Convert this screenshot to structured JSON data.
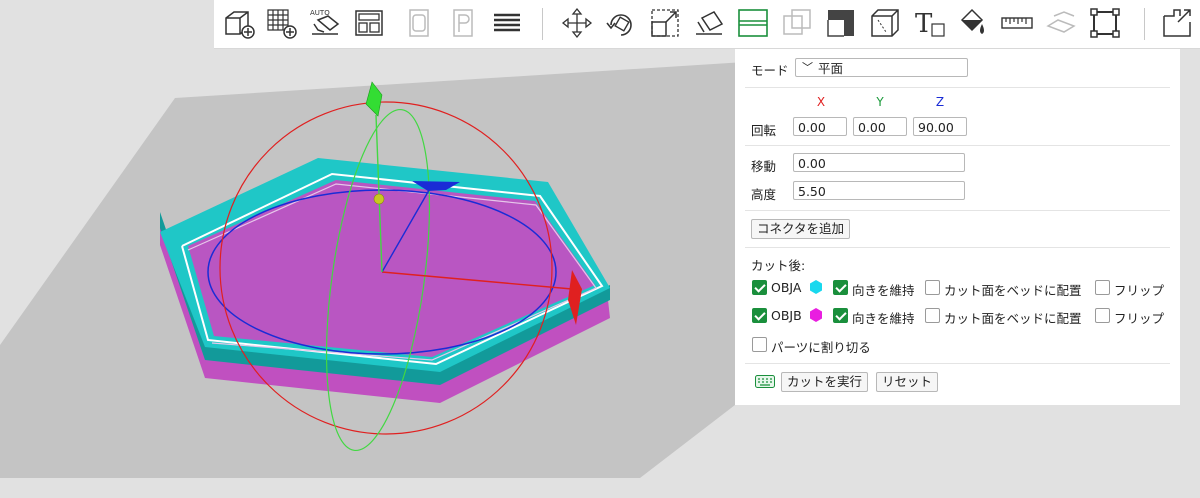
{
  "toolbar": {
    "icons": [
      "add-part-icon",
      "add-grid-icon",
      "auto-arrange-icon",
      "layout-icon",
      "duplicate-icon",
      "paste-icon",
      "layers-icon",
      "move-icon",
      "rotate-icon",
      "scale-icon",
      "place-on-face-icon",
      "cut-icon",
      "boolean-icon",
      "measure-shape-icon",
      "support-icon",
      "text-icon",
      "paint-icon",
      "ruler-icon",
      "seam-icon",
      "variable-layer-icon",
      "split-icon"
    ],
    "auto_label": "AUTO",
    "text_letter": "T"
  },
  "panel": {
    "mode_label": "モード",
    "mode_value": "平面",
    "axis_x": "X",
    "axis_y": "Y",
    "axis_z": "Z",
    "rotate_label": "回転",
    "rotate_x": "0.00",
    "rotate_y": "0.00",
    "rotate_z": "90.00",
    "move_label": "移動",
    "move_value": "0.00",
    "height_label": "高度",
    "height_value": "5.50",
    "add_connector": "コネクタを追加",
    "after_cut": "カット後:",
    "obja": {
      "label": "OBJA",
      "color": "#18d8ee",
      "keep_orientation": "向きを維持",
      "place_on_bed": "カット面をベッドに配置",
      "flip": "フリップ"
    },
    "objb": {
      "label": "OBJB",
      "color": "#e91ee0",
      "keep_orientation": "向きを維持",
      "place_on_bed": "カット面をベッドに配置",
      "flip": "フリップ"
    },
    "split_parts": "パーツに割り切る",
    "execute_cut": "カットを実行",
    "reset": "リセット"
  },
  "colors": {
    "plate": "#c3c3c3",
    "teal": "#18c4c4",
    "magenta": "#c050c0",
    "accent_green": "#1a8f3c"
  }
}
